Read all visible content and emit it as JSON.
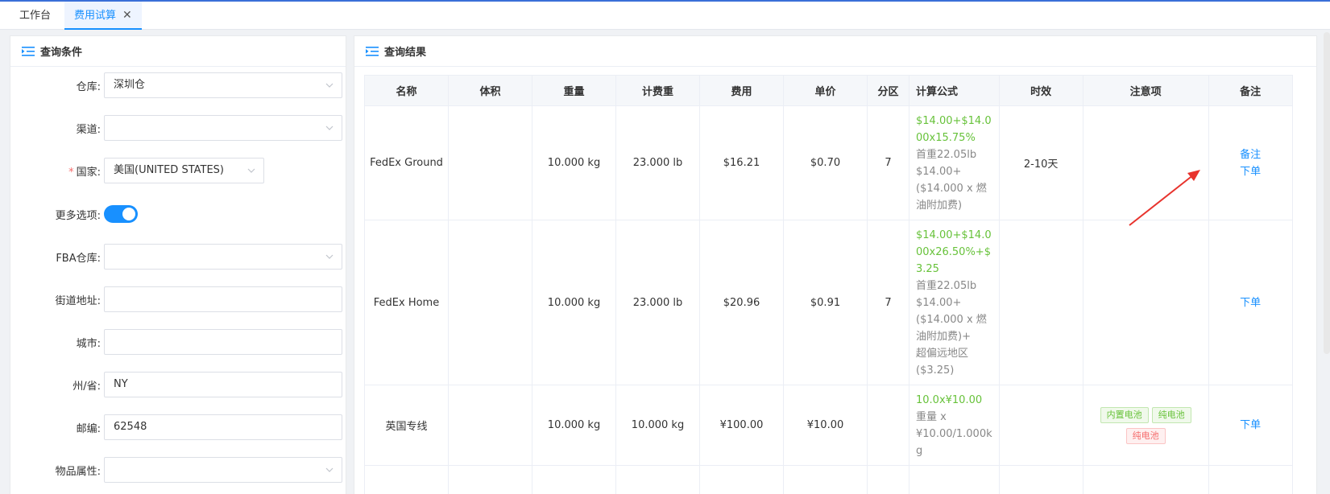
{
  "tabs": [
    {
      "label": "工作台"
    },
    {
      "label": "费用试算"
    }
  ],
  "query_panel": {
    "title": "查询条件",
    "fields": {
      "warehouse": {
        "label": "仓库:",
        "value": "深圳仓"
      },
      "channel": {
        "label": "渠道:",
        "value": ""
      },
      "country": {
        "label": "国家:",
        "required_mark": "*",
        "value": "美国(UNITED STATES)"
      },
      "more_options": {
        "label": "更多选项:",
        "on": true
      },
      "fba_warehouse": {
        "label": "FBA仓库:",
        "value": ""
      },
      "street": {
        "label": "街道地址:",
        "value": ""
      },
      "city": {
        "label": "城市:",
        "value": ""
      },
      "state": {
        "label": "州/省:",
        "value": "NY"
      },
      "zip": {
        "label": "邮编:",
        "value": "62548"
      },
      "item_attr": {
        "label": "物品属性:",
        "value": ""
      }
    }
  },
  "result_panel": {
    "title": "查询结果",
    "columns": [
      "名称",
      "体积",
      "重量",
      "计费重",
      "费用",
      "单价",
      "分区",
      "计算公式",
      "时效",
      "注意项",
      "备注"
    ],
    "rows": [
      {
        "name": "FedEx Ground",
        "volume": "",
        "weight": "10.000 kg",
        "charge_weight": "23.000 lb",
        "fee": "$16.21",
        "unit_price": "$0.70",
        "zone": "7",
        "formula_green": [
          "$14.00+$14.0",
          "00x15.75%"
        ],
        "formula_grey": [
          "首重22.05lb",
          "$14.00+",
          "($14.000 x 燃",
          "油附加费)"
        ],
        "timeliness": "2-10天",
        "tags": [],
        "remark_links": [
          "备注",
          "下单"
        ]
      },
      {
        "name": "FedEx Home",
        "volume": "",
        "weight": "10.000 kg",
        "charge_weight": "23.000 lb",
        "fee": "$20.96",
        "unit_price": "$0.91",
        "zone": "7",
        "formula_green": [
          "$14.00+$14.0",
          "00x26.50%+$",
          "3.25"
        ],
        "formula_grey": [
          "首重22.05lb",
          "$14.00+",
          "($14.000 x 燃",
          "油附加费)+",
          "超偏远地区",
          "($3.25)"
        ],
        "timeliness": "",
        "tags": [],
        "remark_links": [
          "下单"
        ]
      },
      {
        "name": "英国专线",
        "volume": "",
        "weight": "10.000 kg",
        "charge_weight": "10.000 kg",
        "fee": "¥100.00",
        "unit_price": "¥10.00",
        "zone": "",
        "formula_green": [
          "10.0x¥10.00"
        ],
        "formula_grey": [
          "重量 x",
          "¥10.00/1.000k",
          "g"
        ],
        "timeliness": "",
        "tags": [
          {
            "text": "内置电池",
            "color": "green"
          },
          {
            "text": "纯电池",
            "color": "green"
          },
          {
            "text": "纯电池",
            "color": "red"
          }
        ],
        "remark_links": [
          "下单"
        ]
      }
    ]
  },
  "colors": {
    "accent": "#1890ff",
    "formula_green": "#67c23a",
    "arrow_red": "#e8332d"
  }
}
